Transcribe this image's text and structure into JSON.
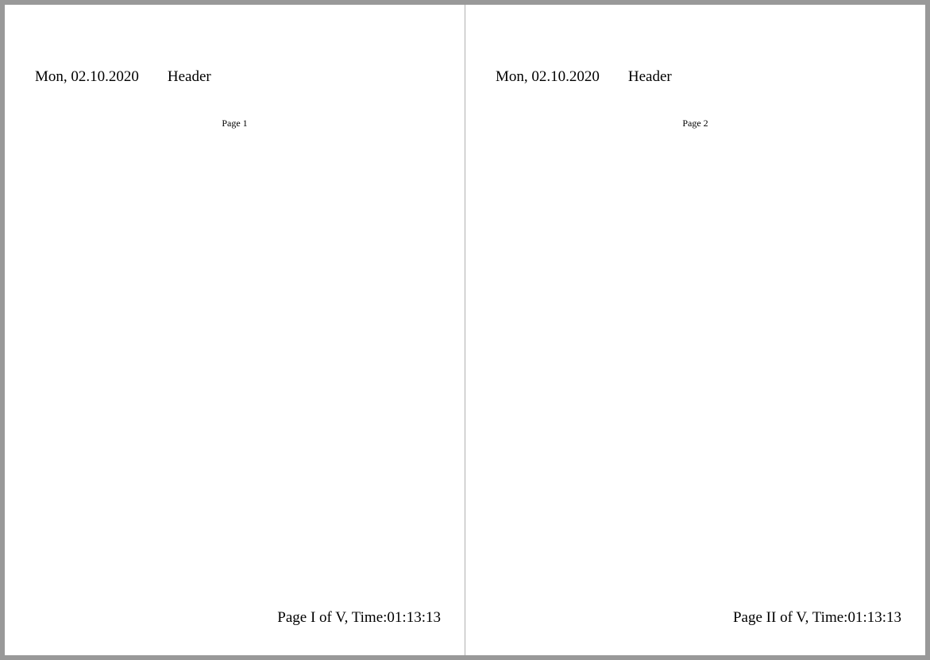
{
  "pages": [
    {
      "header_date": "Mon, 02.10.2020",
      "header_text": "Header",
      "title": "Page 1",
      "footer": "Page I of V, Time:01:13:13"
    },
    {
      "header_date": "Mon, 02.10.2020",
      "header_text": "Header",
      "title": "Page 2",
      "footer": "Page II of V, Time:01:13:13"
    }
  ]
}
